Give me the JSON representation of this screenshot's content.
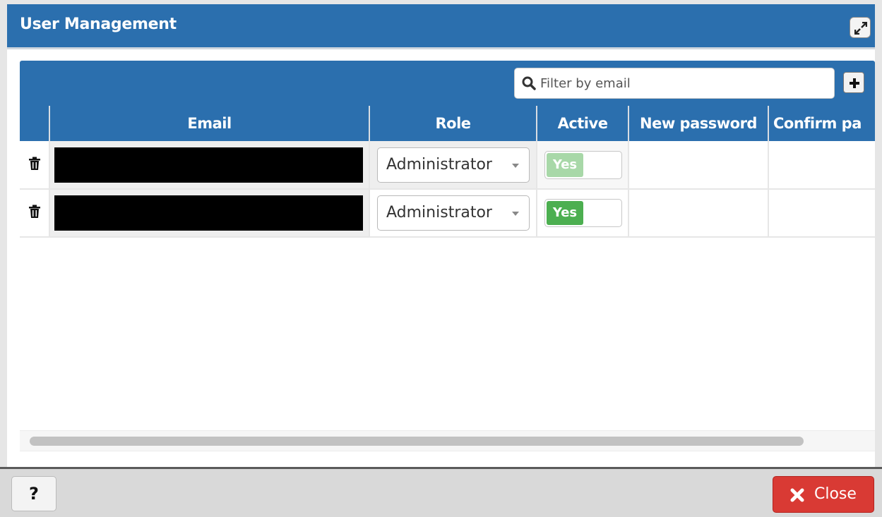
{
  "dialog": {
    "title": "User Management"
  },
  "toolbar": {
    "filter_placeholder": "Filter by email",
    "filter_value": ""
  },
  "table": {
    "columns": [
      "",
      "Email",
      "Role",
      "Active",
      "New password",
      "Confirm pa"
    ],
    "rows": [
      {
        "email": "",
        "role": "Administrator",
        "active": "Yes",
        "active_enabled": false
      },
      {
        "email": "",
        "role": "Administrator",
        "active": "Yes",
        "active_enabled": true
      }
    ]
  },
  "footer": {
    "help_label": "?",
    "close_label": "Close"
  },
  "colors": {
    "header_blue": "#2b6fae",
    "toggle_green": "#4caf50",
    "close_red": "#d93a34"
  }
}
